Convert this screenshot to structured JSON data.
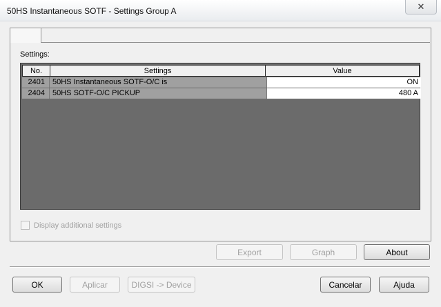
{
  "window": {
    "title": "50HS Instantaneous SOTF - Settings Group A",
    "close_glyph": "✕"
  },
  "panel": {
    "settings_label": "Settings:"
  },
  "table": {
    "headers": {
      "no": "No.",
      "settings": "Settings",
      "value": "Value"
    },
    "rows": [
      {
        "no": "2401",
        "setting": "50HS Instantaneous SOTF-O/C is",
        "value": "ON"
      },
      {
        "no": "2404",
        "setting": "50HS SOTF-O/C PICKUP",
        "value": "480 A"
      }
    ]
  },
  "options": {
    "display_additional_label": "Display additional settings",
    "display_additional_checked": false
  },
  "buttons": {
    "export": "Export",
    "graph": "Graph",
    "about": "About",
    "ok": "OK",
    "apply": "Aplicar",
    "digsi_device": "DIGSI -> Device",
    "cancel": "Cancelar",
    "help": "Ajuda"
  }
}
